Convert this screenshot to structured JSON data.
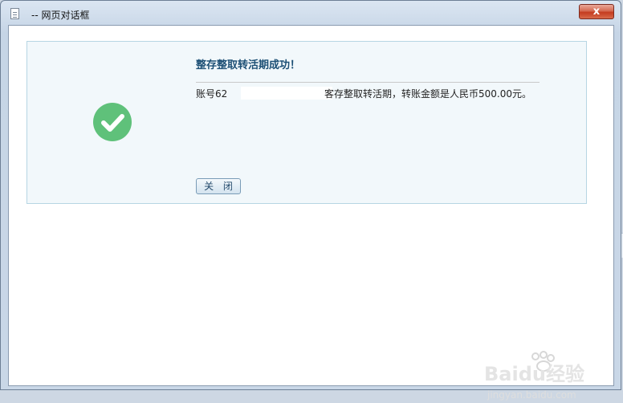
{
  "window": {
    "title": "-- 网页对话框",
    "close_symbol": "x"
  },
  "dialog": {
    "headline": "整存整取转活期成功！",
    "account_prefix": "账号62",
    "message_rest": "客存整取转活期，转账金额是人民币500.00元。",
    "close_button": "关 闭",
    "status_icon": "success-check-icon",
    "accent_color": "#5fc17a",
    "headline_color": "#1c4f75"
  },
  "watermark": {
    "logo_text": "Baidu经验",
    "url": "jingyan.baidu.com"
  }
}
